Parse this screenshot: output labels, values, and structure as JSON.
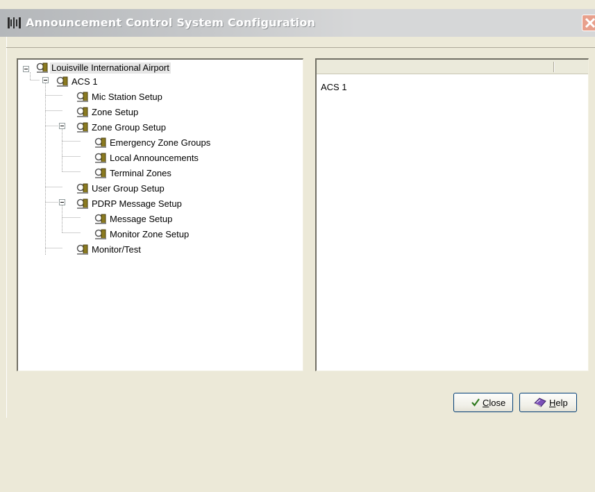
{
  "window": {
    "title": "Announcement Control System Configuration",
    "icons": {
      "app": "bracket-app-icon",
      "close": "close-x-icon"
    }
  },
  "tree": {
    "root": {
      "label": "Louisville International Airport",
      "icon": "magnifier-tool-icon"
    },
    "acs": {
      "label": "ACS 1"
    },
    "mic_station": {
      "label": "Mic Station Setup"
    },
    "zone_setup": {
      "label": "Zone Setup"
    },
    "zone_group": {
      "label": "Zone Group Setup"
    },
    "emergency_groups": {
      "label": "Emergency Zone Groups"
    },
    "local_announcements": {
      "label": "Local Announcements"
    },
    "terminal_zones": {
      "label": "Terminal Zones"
    },
    "user_group": {
      "label": "User Group Setup"
    },
    "pdrp": {
      "label": "PDRP Message Setup"
    },
    "message_setup": {
      "label": "Message Setup"
    },
    "monitor_zone": {
      "label": "Monitor Zone Setup"
    },
    "monitor_test": {
      "label": "Monitor/Test"
    }
  },
  "details": {
    "item": "ACS 1"
  },
  "buttons": {
    "close": {
      "prefix": "",
      "mnemonic": "C",
      "rest": "lose",
      "icon": "checkmark-icon"
    },
    "help": {
      "prefix": "",
      "mnemonic": "H",
      "rest": "elp",
      "icon": "help-book-icon"
    }
  }
}
